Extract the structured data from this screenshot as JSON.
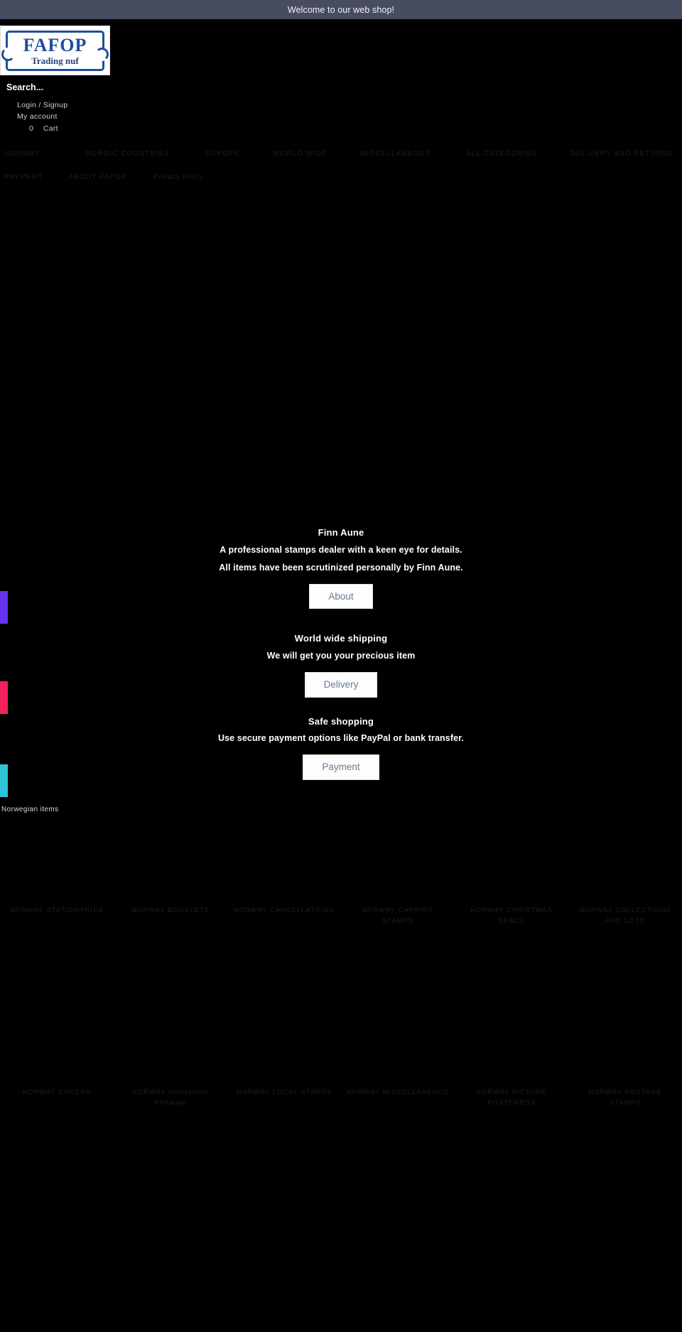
{
  "announcement": {
    "text": "Welcome to our web shop!"
  },
  "brand": {
    "logo_main": "FAFOP",
    "logo_sub": "Trading nuf"
  },
  "search": {
    "placeholder": "Search...",
    "value": ""
  },
  "account": {
    "login_signup": "Login / Signup",
    "my_account": "My account",
    "cart_count": "0",
    "cart_label": "Cart"
  },
  "nav": {
    "items": [
      {
        "label": "NORWAY"
      },
      {
        "label": "NORDIC COUNTRIES"
      },
      {
        "label": "EUROPE"
      },
      {
        "label": "WORLD WIDE"
      },
      {
        "label": "MISCELLANEOUS"
      },
      {
        "label": "ALL CATEGORIES"
      },
      {
        "label": "DELIVERY AND RETURNS"
      },
      {
        "label": "PAYMENT"
      },
      {
        "label": "ABOUT FAFOP"
      },
      {
        "label": "Privacy Policy"
      }
    ]
  },
  "features": [
    {
      "title": "Finn Aune",
      "line1": "A professional stamps dealer with a keen eye for details.",
      "line2": "All items have been scrutinized personally by Finn Aune.",
      "button": "About",
      "bar_color": "#6633ee"
    },
    {
      "title": "World wide shipping",
      "line1": "We will get you your precious item",
      "line2": "",
      "button": "Delivery",
      "bar_color": "#f5225e"
    },
    {
      "title": "Safe shopping",
      "line1": "Use secure payment options like PayPal or bank transfer.",
      "line2": "",
      "button": "Payment",
      "bar_color": "#2ec4d8"
    }
  ],
  "section": {
    "heading": "Norwegian items"
  },
  "categories": [
    {
      "label": "NORWAY STATIONARIES"
    },
    {
      "label": "NORWAY BOOKLETS"
    },
    {
      "label": "NORWAY CANCELLATIONS"
    },
    {
      "label": "NORWAY CARRIER STAMPS"
    },
    {
      "label": "NORWAY CHRISTMAS SEALS"
    },
    {
      "label": "NORWAY COLLECTIONS AND LOTS"
    },
    {
      "label": "NORWAY COVERS"
    },
    {
      "label": "NORWAY Homeplace Philately"
    },
    {
      "label": "NORWAY LOCAL STAMPS"
    },
    {
      "label": "NORWAY MISCELLANEOUS"
    },
    {
      "label": "NORWAY PICTURE POSTCARDS"
    },
    {
      "label": "NORWAY POSTAGE STAMPS"
    }
  ]
}
